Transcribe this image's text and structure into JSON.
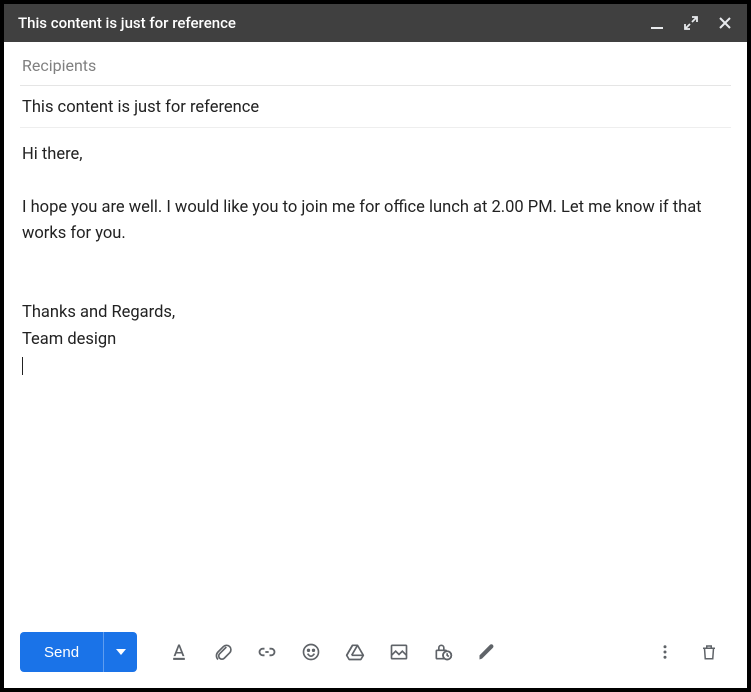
{
  "header": {
    "title": "This content is just for reference"
  },
  "compose": {
    "recipients_placeholder": "Recipients",
    "subject": "This content is just for reference",
    "body_greeting": "Hi there,",
    "body_main": "I hope you are well. I would like you to join me for office lunch at 2.00 PM. Let me know if that works for you.",
    "body_signature_line1": "Thanks and Regards,",
    "body_signature_line2": "Team design"
  },
  "footer": {
    "send_label": "Send"
  }
}
